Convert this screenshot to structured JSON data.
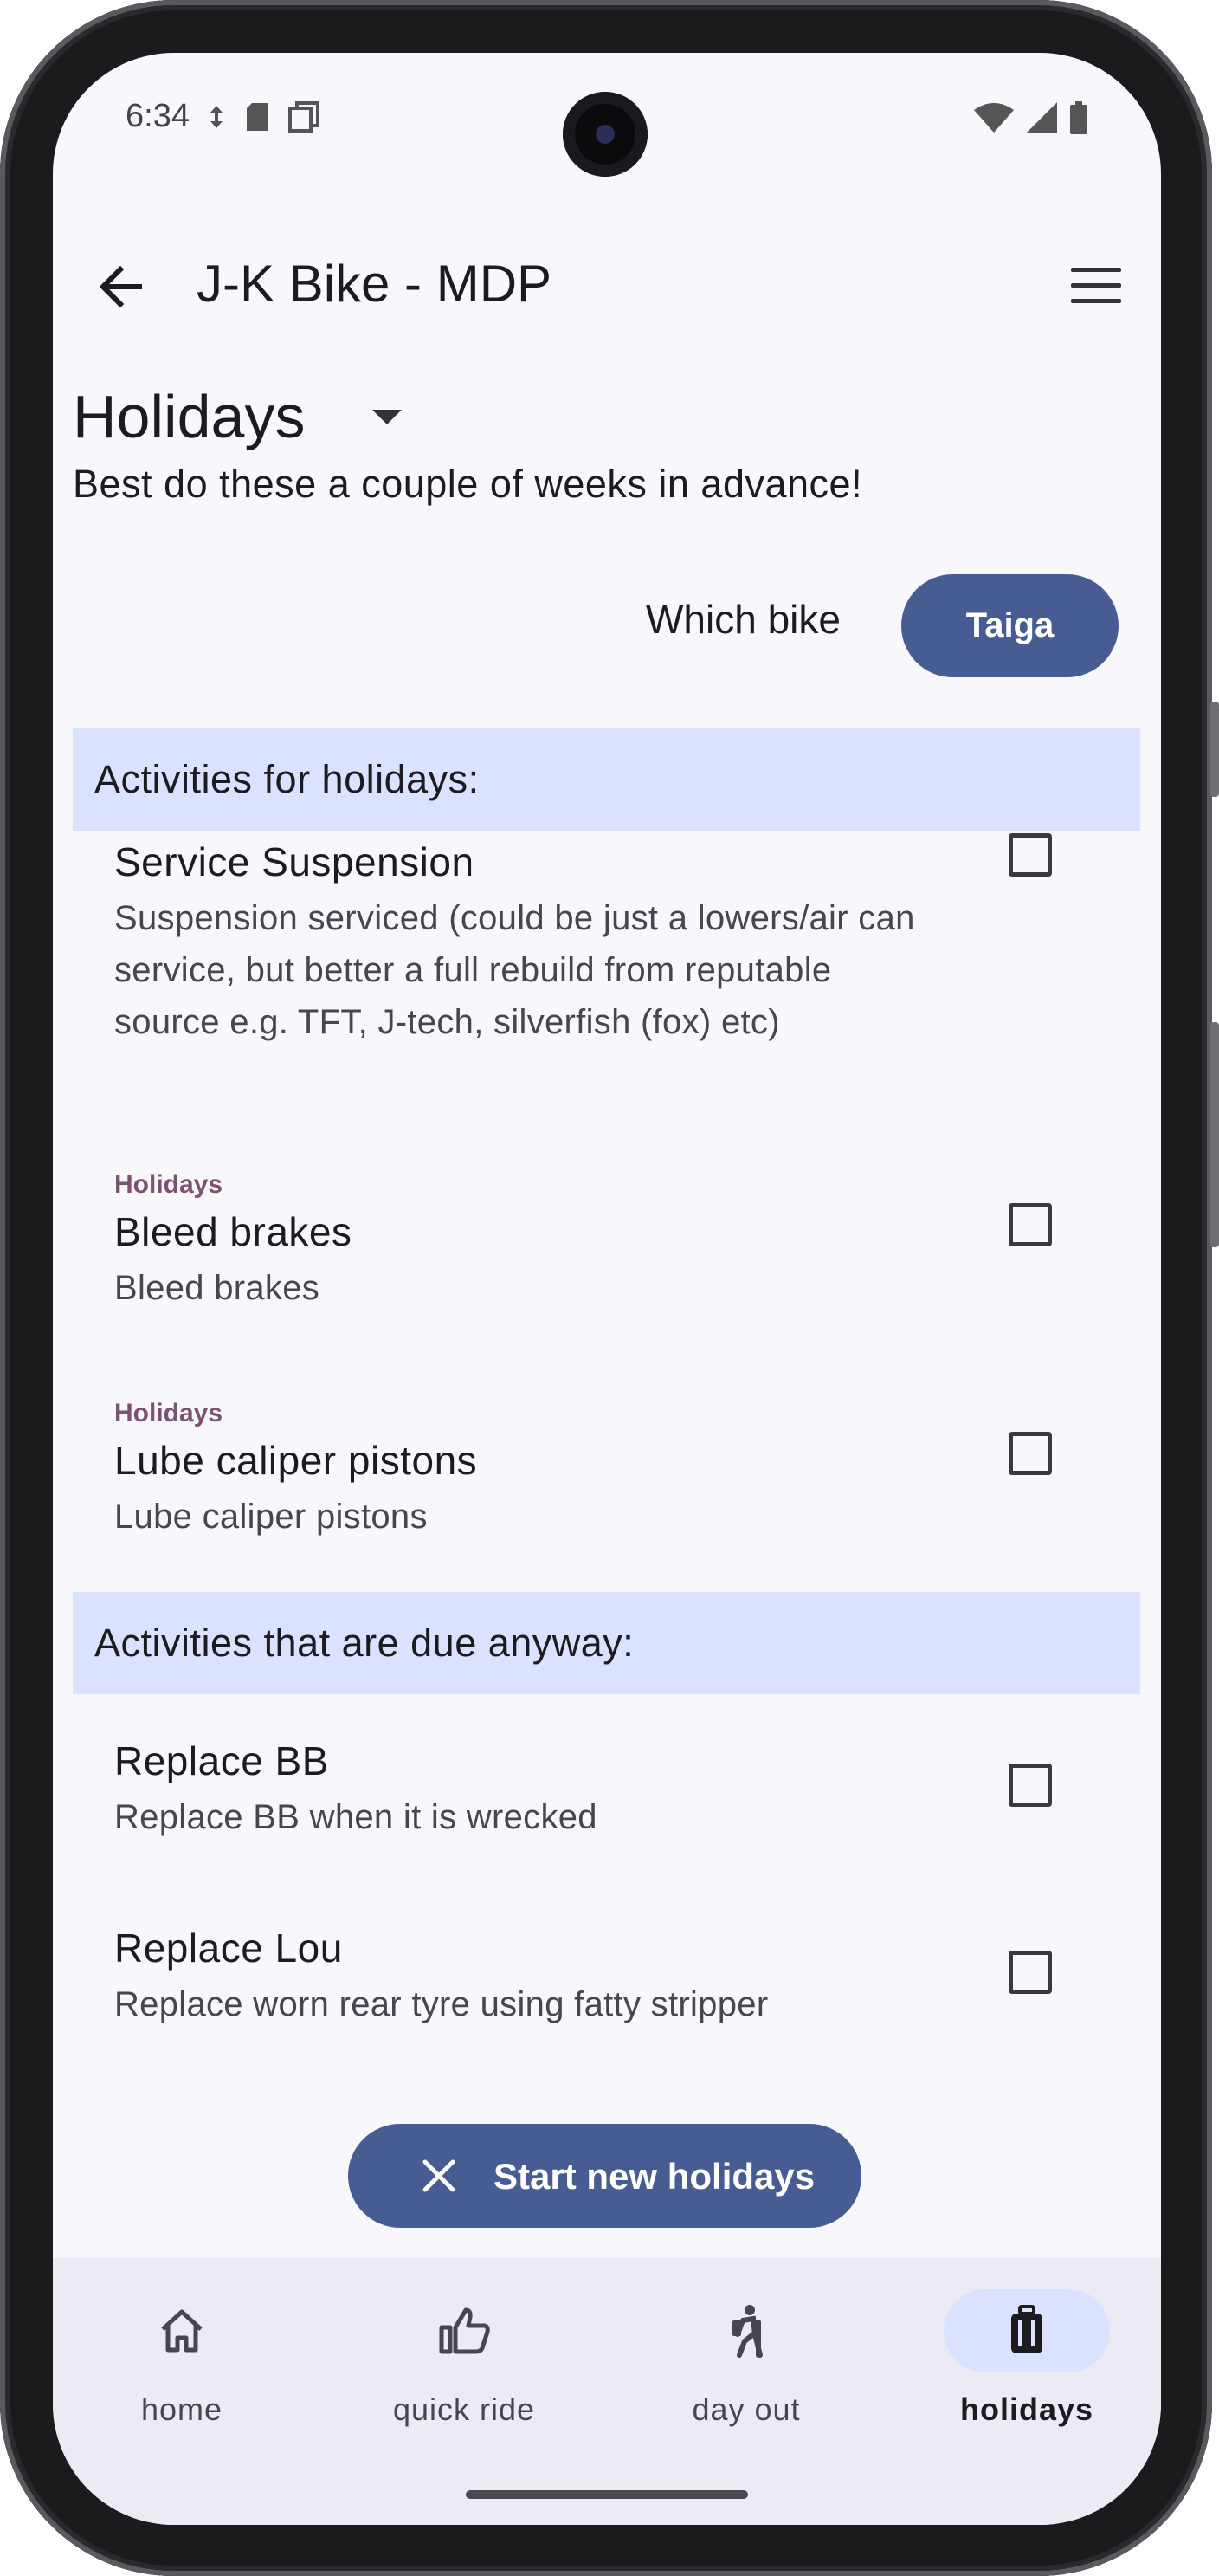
{
  "status_bar": {
    "time": "6:34"
  },
  "app_bar": {
    "title": "J-K Bike - MDP"
  },
  "page": {
    "title": "Holidays",
    "subtitle": "Best do these a couple of weeks in advance!"
  },
  "bike_selector": {
    "label": "Which bike",
    "value": "Taiga"
  },
  "sections": [
    {
      "header": "Activities for holidays:",
      "items": [
        {
          "tag": "",
          "title": "Service Suspension",
          "description": "Suspension serviced (could be just a lowers/air can service, but better a full rebuild from reputable source e.g. TFT, J-tech, silverfish (fox) etc)",
          "checked": false
        },
        {
          "tag": "Holidays",
          "title": "Bleed brakes",
          "description": "Bleed brakes",
          "checked": false
        },
        {
          "tag": "Holidays",
          "title": "Lube caliper pistons",
          "description": "Lube caliper pistons",
          "checked": false
        }
      ]
    },
    {
      "header": "Activities that are due anyway:",
      "items": [
        {
          "title": "Replace BB",
          "description": "Replace BB when it is wrecked",
          "checked": false
        },
        {
          "title": "Replace Lou",
          "description": "Replace worn rear tyre using fatty stripper",
          "checked": false
        }
      ]
    }
  ],
  "fab": {
    "label": "Start new holidays",
    "icon": "close-icon"
  },
  "bottom_nav": [
    {
      "label": "home",
      "icon": "home-icon",
      "active": false
    },
    {
      "label": "quick ride",
      "icon": "thumb-up-icon",
      "active": false
    },
    {
      "label": "day out",
      "icon": "hiker-icon",
      "active": false
    },
    {
      "label": "holidays",
      "icon": "luggage-icon",
      "active": true
    }
  ],
  "colors": {
    "primary": "#475c93",
    "section_bg": "#dae2ff",
    "tag": "#7d5270",
    "background": "#f8f7fc"
  }
}
